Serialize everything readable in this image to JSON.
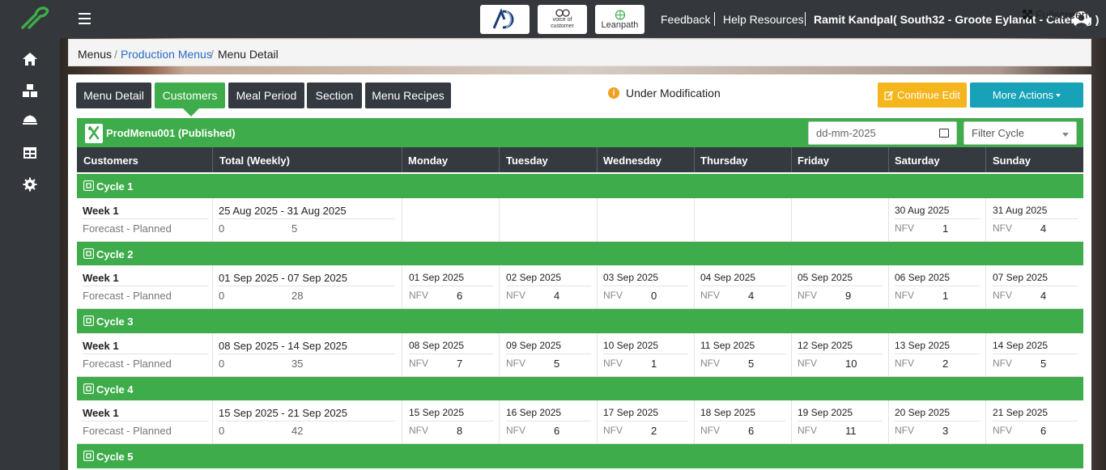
{
  "header": {
    "brands": [
      "AD",
      "voice of customer",
      "Leanpath"
    ],
    "links": [
      "Feedback",
      "Help Resources"
    ],
    "user": "Ramit Kandpal( South32 - Groote Eylandt - Catering )"
  },
  "sidebar": {
    "icons": [
      "home-icon",
      "boxes-icon",
      "dish-icon",
      "table-icon",
      "settings-icon"
    ]
  },
  "breadcrumb": {
    "items": [
      "Menus",
      "Production Menus",
      "Menu Detail"
    ],
    "fullscreen_label": "Fullscreen"
  },
  "tabs": [
    "Menu Detail",
    "Customers",
    "Meal Period",
    "Section",
    "Menu Recipes"
  ],
  "status": {
    "label": "Under Modification"
  },
  "actions": {
    "continue_label": "Continue Edit",
    "more_label": "More Actions"
  },
  "menu": {
    "title": "ProdMenu001 (Published)",
    "date_placeholder": "dd-mm-2025",
    "filter_placeholder": "Filter Cycle"
  },
  "table": {
    "headers": [
      "Customers",
      "Total (Weekly)",
      "Monday",
      "Tuesday",
      "Wednesday",
      "Thursday",
      "Friday",
      "Saturday",
      "Sunday"
    ],
    "week_label": "Week 1",
    "forecast_label": "Forecast - Planned",
    "nfv_label": "NFV",
    "cycles": [
      {
        "name": "Cycle 1",
        "range": "25 Aug 2025 - 31 Aug 2025",
        "forecast": "0",
        "planned": "5",
        "days": [
          null,
          null,
          null,
          null,
          null,
          {
            "date": "30 Aug 2025",
            "value": "1"
          },
          {
            "date": "31 Aug 2025",
            "value": "4"
          }
        ]
      },
      {
        "name": "Cycle 2",
        "range": "01 Sep 2025 - 07 Sep 2025",
        "forecast": "0",
        "planned": "28",
        "days": [
          {
            "date": "01 Sep 2025",
            "value": "6"
          },
          {
            "date": "02 Sep 2025",
            "value": "4"
          },
          {
            "date": "03 Sep 2025",
            "value": "0"
          },
          {
            "date": "04 Sep 2025",
            "value": "4"
          },
          {
            "date": "05 Sep 2025",
            "value": "9"
          },
          {
            "date": "06 Sep 2025",
            "value": "1"
          },
          {
            "date": "07 Sep 2025",
            "value": "4"
          }
        ]
      },
      {
        "name": "Cycle 3",
        "range": "08 Sep 2025 - 14 Sep 2025",
        "forecast": "0",
        "planned": "35",
        "days": [
          {
            "date": "08 Sep 2025",
            "value": "7"
          },
          {
            "date": "09 Sep 2025",
            "value": "5"
          },
          {
            "date": "10 Sep 2025",
            "value": "1"
          },
          {
            "date": "11 Sep 2025",
            "value": "5"
          },
          {
            "date": "12 Sep 2025",
            "value": "10"
          },
          {
            "date": "13 Sep 2025",
            "value": "2"
          },
          {
            "date": "14 Sep 2025",
            "value": "5"
          }
        ]
      },
      {
        "name": "Cycle 4",
        "range": "15 Sep 2025 - 21 Sep 2025",
        "forecast": "0",
        "planned": "42",
        "days": [
          {
            "date": "15 Sep 2025",
            "value": "8"
          },
          {
            "date": "16 Sep 2025",
            "value": "6"
          },
          {
            "date": "17 Sep 2025",
            "value": "2"
          },
          {
            "date": "18 Sep 2025",
            "value": "6"
          },
          {
            "date": "19 Sep 2025",
            "value": "11"
          },
          {
            "date": "20 Sep 2025",
            "value": "3"
          },
          {
            "date": "21 Sep 2025",
            "value": "6"
          }
        ]
      },
      {
        "name": "Cycle 5"
      }
    ]
  },
  "colors": {
    "green": "#3eac4a",
    "dark": "#343a40",
    "warning": "#f5b61d",
    "info": "#17a2b8",
    "link": "#2b6cc4"
  }
}
